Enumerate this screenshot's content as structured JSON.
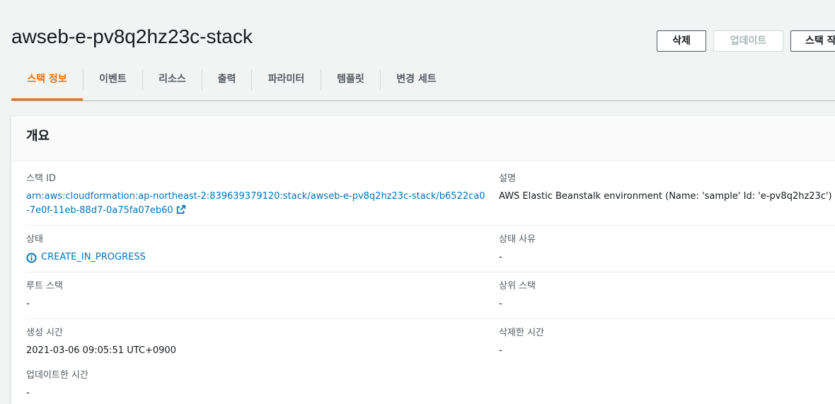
{
  "header": {
    "stack_name": "awseb-e-pv8q2hz23c-stack",
    "actions": {
      "delete_label": "삭제",
      "update_label": "업데이트",
      "stack_actions_label": "스택 작"
    }
  },
  "tabs": [
    {
      "label": "스택 정보",
      "active": true
    },
    {
      "label": "이벤트",
      "active": false
    },
    {
      "label": "리소스",
      "active": false
    },
    {
      "label": "출력",
      "active": false
    },
    {
      "label": "파라미터",
      "active": false
    },
    {
      "label": "템플릿",
      "active": false
    },
    {
      "label": "변경 세트",
      "active": false
    }
  ],
  "overview": {
    "title": "개요",
    "stack_id": {
      "label": "스택 ID",
      "value": "arn:aws:cloudformation:ap-northeast-2:839639379120:stack/awseb-e-pv8q2hz23c-stack/b6522ca0-7e0f-11eb-88d7-0a75fa07eb60"
    },
    "description": {
      "label": "설명",
      "value": "AWS Elastic Beanstalk environment (Name: 'sample' Id: 'e-pv8q2hz23c')"
    },
    "status": {
      "label": "상태",
      "value": "CREATE_IN_PROGRESS"
    },
    "status_reason": {
      "label": "상태 사유",
      "value": "-"
    },
    "root_stack": {
      "label": "루트 스택",
      "value": "-"
    },
    "parent_stack": {
      "label": "상위 스택",
      "value": "-"
    },
    "created_time": {
      "label": "생성 시간",
      "value": "2021-03-06 09:05:51 UTC+0900"
    },
    "deleted_time": {
      "label": "삭제한 시간",
      "value": "-"
    },
    "updated_time": {
      "label": "업데이트한 시간",
      "value": "-"
    }
  },
  "colors": {
    "accent": "#ec7211",
    "link": "#0073bb",
    "background": "#f2f3f3"
  }
}
